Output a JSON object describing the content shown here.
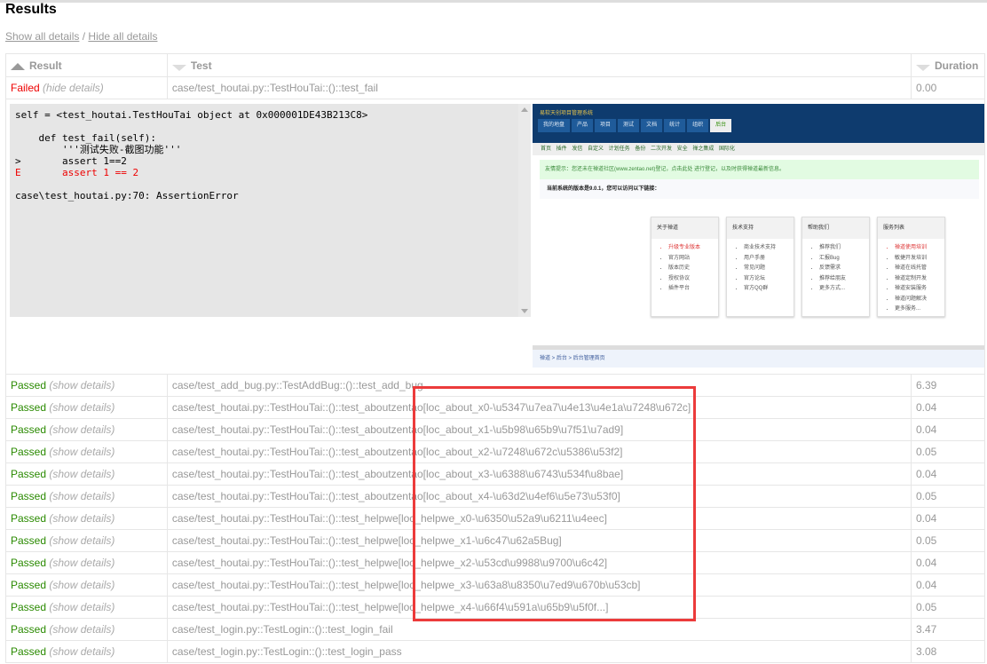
{
  "title": "Results",
  "links": {
    "show_all": "Show all details",
    "separator": " / ",
    "hide_all": "Hide all details"
  },
  "headers": {
    "result": "Result",
    "test": "Test",
    "duration": "Duration"
  },
  "failed_row": {
    "result": "Failed",
    "details": "(hide details)",
    "test": "case/test_houtai.py::TestHouTai::()::test_fail",
    "duration": "0.00"
  },
  "log": {
    "line1": "self = <test_houtai.TestHouTai object at 0x000001DE43B213C8>",
    "line2": "    def test_fail(self):",
    "line3": "        '''测试失败-截图功能'''",
    "line4": ">       assert 1==2",
    "line5": "E       assert 1 == 2",
    "line6": "case\\test_houtai.py:70: AssertionError"
  },
  "screenshot": {
    "brand": "易软天创项目管理系统",
    "tabs": [
      "我的地盘",
      "产品",
      "项目",
      "测试",
      "文档",
      "统计",
      "组织",
      "后台"
    ],
    "subnav": "首页 插件 发信 自定义 计划任务 备份 二次开发 安全 禅之集成 国际化",
    "notice": "友情提示：您还未在禅道社区(www.zentao.net)登记，点击此处 进行登记，以及时获得禅道最新信息。",
    "version": "当前系统的版本是9.0.1，您可以访问以下链接：",
    "cards": [
      {
        "title": "关于禅道",
        "items": [
          "升级专业版本",
          "官方网站",
          "版本历史",
          "授权协议",
          "插件平台"
        ]
      },
      {
        "title": "技术支持",
        "items": [
          "商业技术支持",
          "用户手册",
          "常见问题",
          "官方论坛",
          "官方QQ群"
        ]
      },
      {
        "title": "帮助我们",
        "items": [
          "推荐我们",
          "汇报Bug",
          "反馈需求",
          "推荐给朋友",
          "更多方式..."
        ]
      },
      {
        "title": "服务列表",
        "items": [
          "禅道使用培训",
          "敏捷开发培训",
          "禅道在线托管",
          "禅道定制开发",
          "禅道安装服务",
          "禅道问题解决",
          "更多服务..."
        ]
      }
    ],
    "footer": "禅道 > 后台 > 后台管理首页"
  },
  "rows": [
    {
      "result": "Passed",
      "details": "(show details)",
      "test": "case/test_add_bug.py::TestAddBug::()::test_add_bug",
      "duration": "6.39"
    },
    {
      "result": "Passed",
      "details": "(show details)",
      "test": "case/test_houtai.py::TestHouTai::()::test_aboutzentao[loc_about_x0-\\u5347\\u7ea7\\u4e13\\u4e1a\\u7248\\u672c]",
      "duration": "0.04"
    },
    {
      "result": "Passed",
      "details": "(show details)",
      "test": "case/test_houtai.py::TestHouTai::()::test_aboutzentao[loc_about_x1-\\u5b98\\u65b9\\u7f51\\u7ad9]",
      "duration": "0.04"
    },
    {
      "result": "Passed",
      "details": "(show details)",
      "test": "case/test_houtai.py::TestHouTai::()::test_aboutzentao[loc_about_x2-\\u7248\\u672c\\u5386\\u53f2]",
      "duration": "0.05"
    },
    {
      "result": "Passed",
      "details": "(show details)",
      "test": "case/test_houtai.py::TestHouTai::()::test_aboutzentao[loc_about_x3-\\u6388\\u6743\\u534f\\u8bae]",
      "duration": "0.04"
    },
    {
      "result": "Passed",
      "details": "(show details)",
      "test": "case/test_houtai.py::TestHouTai::()::test_aboutzentao[loc_about_x4-\\u63d2\\u4ef6\\u5e73\\u53f0]",
      "duration": "0.05"
    },
    {
      "result": "Passed",
      "details": "(show details)",
      "test": "case/test_houtai.py::TestHouTai::()::test_helpwe[loc_helpwe_x0-\\u6350\\u52a9\\u6211\\u4eec]",
      "duration": "0.04"
    },
    {
      "result": "Passed",
      "details": "(show details)",
      "test": "case/test_houtai.py::TestHouTai::()::test_helpwe[loc_helpwe_x1-\\u6c47\\u62a5Bug]",
      "duration": "0.05"
    },
    {
      "result": "Passed",
      "details": "(show details)",
      "test": "case/test_houtai.py::TestHouTai::()::test_helpwe[loc_helpwe_x2-\\u53cd\\u9988\\u9700\\u6c42]",
      "duration": "0.04"
    },
    {
      "result": "Passed",
      "details": "(show details)",
      "test": "case/test_houtai.py::TestHouTai::()::test_helpwe[loc_helpwe_x3-\\u63a8\\u8350\\u7ed9\\u670b\\u53cb]",
      "duration": "0.04"
    },
    {
      "result": "Passed",
      "details": "(show details)",
      "test": "case/test_houtai.py::TestHouTai::()::test_helpwe[loc_helpwe_x4-\\u66f4\\u591a\\u65b9\\u5f0f...]",
      "duration": "0.05"
    },
    {
      "result": "Passed",
      "details": "(show details)",
      "test": "case/test_login.py::TestLogin::()::test_login_fail",
      "duration": "3.47"
    },
    {
      "result": "Passed",
      "details": "(show details)",
      "test": "case/test_login.py::TestLogin::()::test_login_pass",
      "duration": "3.08"
    }
  ],
  "colors": {
    "failed": "#ee0000",
    "passed": "#2a8a00",
    "highlight": "#ec3b3b"
  }
}
